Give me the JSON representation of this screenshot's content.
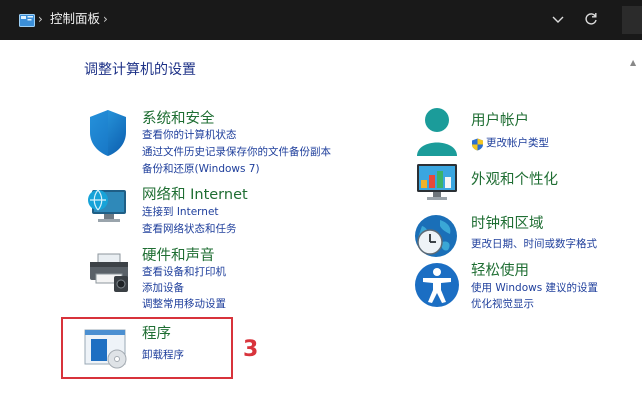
{
  "address_bar": {
    "path": "控制面板",
    "icons": [
      "control-panel-icon",
      "chevron-right-icon",
      "chevron-down-icon",
      "refresh-icon"
    ]
  },
  "page": {
    "title": "调整计算机的设置"
  },
  "left_categories": [
    {
      "title": "系统和安全",
      "icon": "shield-icon",
      "links": [
        "查看你的计算机状态",
        "通过文件历史记录保存你的文件备份副本",
        "备份和还原(Windows 7)"
      ]
    },
    {
      "title": "网络和 Internet",
      "icon": "network-icon",
      "links": [
        "连接到 Internet",
        "查看网络状态和任务"
      ]
    },
    {
      "title": "硬件和声音",
      "icon": "printer-icon",
      "links": [
        "查看设备和打印机",
        "添加设备",
        "调整常用移动设置"
      ]
    },
    {
      "title": "程序",
      "icon": "programs-icon",
      "links": [
        "卸载程序"
      ]
    }
  ],
  "right_categories": [
    {
      "title": "用户帐户",
      "icon": "user-accounts-icon",
      "links": [
        "更改帐户类型"
      ]
    },
    {
      "title": "外观和个性化",
      "icon": "appearance-icon",
      "links": []
    },
    {
      "title": "时钟和区域",
      "icon": "clock-globe-icon",
      "links": [
        "更改日期、时间或数字格式"
      ]
    },
    {
      "title": "轻松使用",
      "icon": "accessibility-icon",
      "links": [
        "使用 Windows 建议的设置",
        "优化视觉显示"
      ]
    }
  ],
  "annotation": {
    "step_number": "3",
    "color": "#d8333b"
  },
  "colors": {
    "category_title": "#1f6e33",
    "link": "#1f3f9c",
    "heading": "#1e3287",
    "topbar": "#191919"
  }
}
